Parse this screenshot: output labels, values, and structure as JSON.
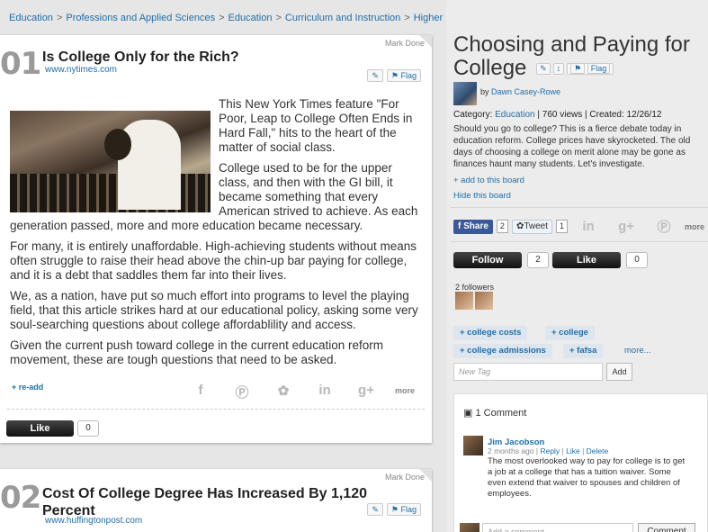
{
  "breadcrumb": [
    "Education",
    "Professions and Applied Sciences",
    "Education",
    "Curriculum and Instruction",
    "Higher Education"
  ],
  "breadcrumb_sep": ">",
  "post1": {
    "mark_done": "Mark Done",
    "number": "01",
    "title": "Is College Only for the Rich?",
    "source": "www.nytimes.com",
    "flag": "Flag",
    "paragraphs": [
      "This New York Times feature \"For Poor, Leap to College Often Ends in Hard Fall,\" hits to the heart of the matter of social class.",
      "College used to be for the upper class, and then with the GI bill, it became something that every American strived to achieve.  As each generation passed, more and more education became necessary.",
      "For many, it is entirely unaffordable.  High-achieving students without means often struggle to raise their head above the chin-up bar paying for college, and it is a debt that saddles them far into their lives.",
      "We, as a nation, have put so much effort into programs to level the playing field, that this article strikes hard at our educational policy, asking some very soul-searching questions about college affordablility and access.",
      "Given the current push toward college in the current education reform movement, these are tough questions that need to be asked."
    ],
    "readd": "+ re-add",
    "more": "more",
    "like_label": "Like",
    "like_count": "0"
  },
  "post2": {
    "mark_done": "Mark Done",
    "number": "02",
    "title": "Cost Of College Degree Has Increased By 1,120 Percent",
    "source": "www.huffingtonpost.com",
    "flag": "Flag"
  },
  "board": {
    "title": "Choosing and Paying for College",
    "flag": "Flag",
    "by": "by",
    "author": "Dawn Casey-Rowe",
    "category_label": "Category:",
    "category": "Education",
    "stats": "| 760 views | Created: 12/26/12",
    "description": "Should you go to college? This is a fierce debate today in education reform. College prices have skyrocketed. The old days of choosing a college on merit alone may be gone as finances haunt many students. Let's investigate.",
    "add_link": "+ add to this board",
    "hide_link": "Hide this board",
    "share_label": "Share",
    "share_count": "2",
    "tweet_label": "Tweet",
    "tweet_count": "1",
    "more": "more",
    "follow_label": "Follow",
    "follow_count": "2",
    "like_label": "Like",
    "like_count": "0",
    "followers": "2 followers",
    "tags": [
      "+ college costs",
      "+ college",
      "+ college admissions",
      "+ fafsa"
    ],
    "more_tags": "more...",
    "new_tag_placeholder": "New Tag",
    "add_label": "Add"
  },
  "comments": {
    "header": "1 Comment",
    "name": "Jim Jacobson",
    "time": "2 months ago",
    "reply": "Reply",
    "like": "Like",
    "delete": "Delete",
    "text": "The most overlooked way to pay for college is to get a job at a college that has a tuition waiver. Some even extend that waiver to spouses and children of employees.",
    "input_placeholder": "Add a comment...",
    "submit_label": "Comment"
  },
  "icons": [
    "edit-icon",
    "flag-icon",
    "move-icon",
    "facebook-icon",
    "pinterest-icon",
    "twitter-icon",
    "linkedin-icon",
    "googleplus-icon",
    "comment-icon"
  ],
  "colors": {
    "link": "#1f6fa8",
    "facebook": "#3b5998",
    "dark_button": "#222222",
    "tag_bg": "#dde5ee"
  }
}
